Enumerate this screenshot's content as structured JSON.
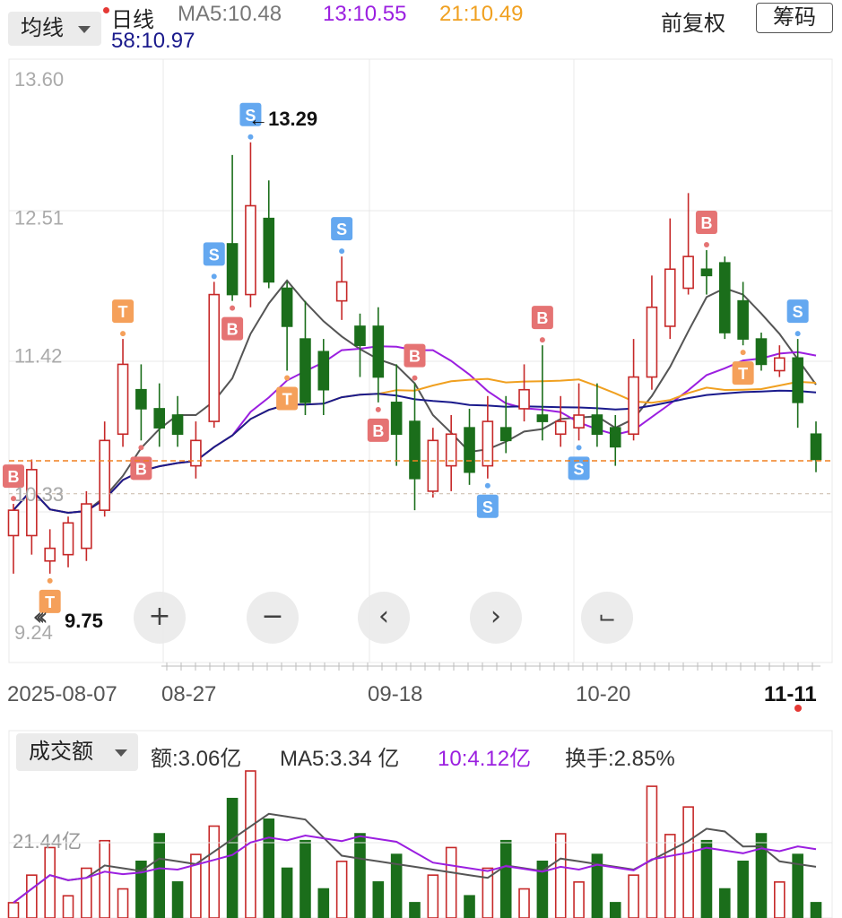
{
  "header": {
    "ma_selector": "均线",
    "period": "日线",
    "ma5": "MA5:10.48",
    "ma13": "13:10.55",
    "ma21": "21:10.49",
    "ma58": "58:10.97",
    "adjust": "前复权",
    "chip_button": "筹码",
    "colors": {
      "ma5": "#555555",
      "ma13": "#9b1fe0",
      "ma21": "#f0a020",
      "ma58": "#1a1a8c",
      "up": "#c62828",
      "down": "#1b6e1b"
    }
  },
  "controls": [
    "collapse-icon",
    "zoom-in-icon",
    "zoom-out-icon",
    "left-arrow-icon",
    "right-arrow-icon",
    "fullscreen-icon"
  ],
  "volume_header": {
    "selector": "成交额",
    "amount": "额:3.06亿",
    "ma5": "MA5:3.34 亿",
    "ma10": "10:4.12亿",
    "turnover": "换手:2.85%"
  },
  "chart_data": [
    {
      "type": "candlestick",
      "title": "",
      "y_ticks": [
        "13.60",
        "12.51",
        "11.42",
        "10.33",
        "9.24"
      ],
      "ylim": [
        9.24,
        13.6
      ],
      "x_ticks": [
        "2025-08-07",
        "08-27",
        "09-18",
        "10-20",
        "11-11"
      ],
      "x_tick_index": [
        0,
        13,
        29,
        44,
        59
      ],
      "markers": {
        "high": "←13.29",
        "low": "9.75",
        "price_left": "10.33"
      },
      "current_price": 10.59,
      "candles": [
        [
          10.0,
          10.2,
          9.7,
          10.25
        ],
        [
          10.0,
          10.52,
          9.85,
          10.6
        ],
        [
          9.8,
          9.9,
          9.7,
          10.05
        ],
        [
          9.85,
          10.1,
          9.75,
          10.15
        ],
        [
          9.9,
          10.25,
          9.8,
          10.35
        ],
        [
          10.2,
          10.75,
          10.15,
          10.9
        ],
        [
          10.8,
          11.35,
          10.7,
          11.55
        ],
        [
          11.15,
          11.0,
          10.75,
          11.35
        ],
        [
          11.0,
          10.85,
          10.7,
          11.2
        ],
        [
          10.95,
          10.8,
          10.7,
          11.1
        ],
        [
          10.55,
          10.75,
          10.45,
          10.9
        ],
        [
          10.9,
          11.9,
          10.85,
          12.0
        ],
        [
          12.3,
          11.9,
          11.85,
          13.0
        ],
        [
          11.9,
          12.6,
          11.8,
          13.1
        ],
        [
          12.5,
          12.0,
          11.95,
          12.8
        ],
        [
          11.95,
          11.65,
          11.3,
          12.0
        ],
        [
          11.55,
          11.05,
          10.95,
          11.85
        ],
        [
          11.45,
          11.15,
          10.95,
          11.55
        ],
        [
          11.85,
          12.0,
          11.7,
          12.2
        ],
        [
          11.65,
          11.5,
          11.25,
          11.75
        ],
        [
          11.65,
          11.25,
          11.05,
          11.8
        ],
        [
          11.05,
          10.8,
          10.55,
          11.35
        ],
        [
          10.9,
          10.45,
          10.2,
          11.2
        ],
        [
          10.35,
          10.75,
          10.3,
          10.85
        ],
        [
          10.55,
          10.8,
          10.35,
          10.95
        ],
        [
          10.85,
          10.5,
          10.4,
          11.0
        ],
        [
          10.55,
          10.9,
          10.45,
          11.1
        ],
        [
          10.85,
          10.75,
          10.65,
          11.1
        ],
        [
          11.0,
          11.15,
          10.9,
          11.35
        ],
        [
          10.95,
          10.9,
          10.75,
          11.5
        ],
        [
          10.8,
          10.9,
          10.7,
          11.1
        ],
        [
          10.85,
          10.95,
          10.75,
          11.2
        ],
        [
          10.95,
          10.8,
          10.7,
          11.2
        ],
        [
          10.85,
          10.7,
          10.55,
          10.95
        ],
        [
          10.8,
          11.25,
          10.75,
          11.55
        ],
        [
          11.25,
          11.8,
          11.15,
          12.05
        ],
        [
          11.65,
          12.1,
          11.55,
          12.5
        ],
        [
          11.95,
          12.2,
          11.9,
          12.7
        ],
        [
          12.1,
          12.05,
          11.9,
          12.25
        ],
        [
          12.15,
          11.6,
          11.55,
          12.2
        ],
        [
          11.85,
          11.55,
          11.5,
          12.0
        ],
        [
          11.55,
          11.35,
          11.3,
          11.6
        ],
        [
          11.3,
          11.4,
          11.25,
          11.5
        ],
        [
          11.4,
          11.05,
          10.85,
          11.55
        ],
        [
          10.8,
          10.6,
          10.5,
          10.9
        ]
      ]
    },
    {
      "type": "bar",
      "title": "",
      "y_ticks": [
        "21.44亿"
      ]
    }
  ]
}
